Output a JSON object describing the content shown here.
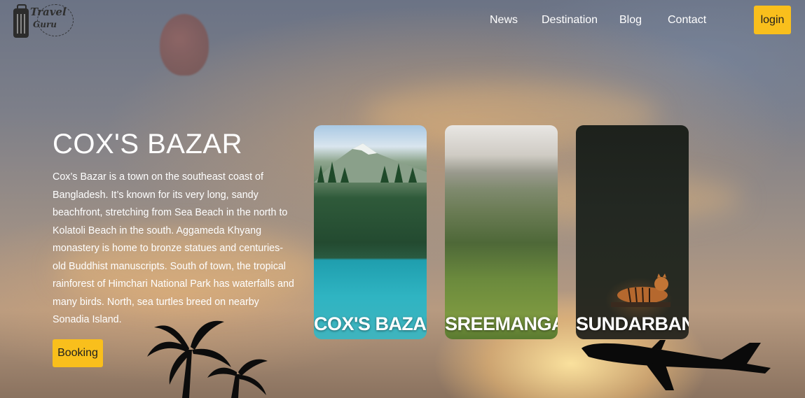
{
  "header": {
    "logo": {
      "line1": "Travel",
      "line2": "Guru"
    },
    "nav": [
      "News",
      "Destination",
      "Blog",
      "Contact"
    ],
    "login_label": "login"
  },
  "hero": {
    "title": "COX'S BAZAR",
    "description": "Cox’s Bazar is a town on the southeast coast of Bangladesh. It’s known for its very long, sandy beachfront, stretching from Sea Beach in the north to Kolatoli Beach in the south. Aggameda Khyang monastery is home to bronze statues and centuries-old Buddhist manuscripts. South of town, the tropical rainforest of Himchari National Park has waterfalls and many birds. North, sea turtles breed on nearby Sonadia Island.",
    "booking_label": "Booking"
  },
  "destinations": [
    {
      "label": "COX'S BAZAR"
    },
    {
      "label": "SREEMANGAL"
    },
    {
      "label": "SUNDARBAN"
    }
  ],
  "colors": {
    "accent": "#f9bf1c",
    "text": "#ffffff"
  }
}
